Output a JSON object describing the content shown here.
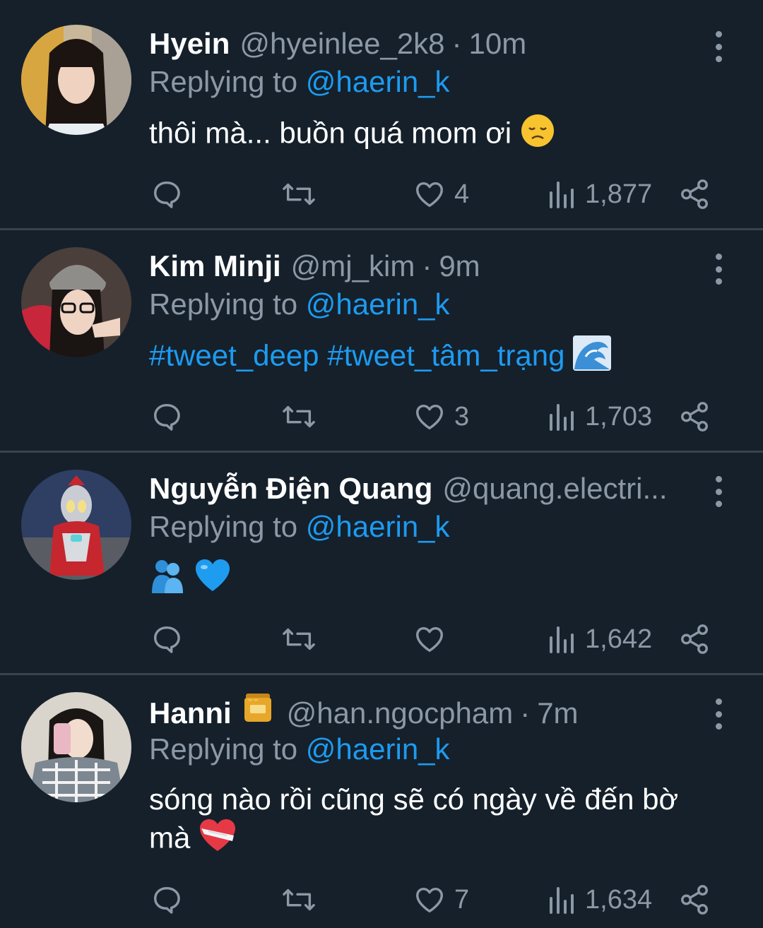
{
  "reply_prefix": "Replying to",
  "tweets": [
    {
      "name": "Hyein",
      "handle": "@hyeinlee_2k8",
      "separator": "·",
      "time": "10m",
      "reply_to": "@haerin_k",
      "text": "thôi mà... buồn quá mom ơi",
      "text_emoji": "disappointed-face",
      "likes": "4",
      "views": "1,877"
    },
    {
      "name": "Kim Minji",
      "handle": "@mj_kim",
      "separator": "·",
      "time": "9m",
      "reply_to": "@haerin_k",
      "hashtag1": "#tweet_deep",
      "hashtag2": "#tweet_tâm_trạng",
      "text_emoji": "water-wave",
      "likes": "3",
      "views": "1,703"
    },
    {
      "name": "Nguyễn Điện Quang",
      "handle": "@quang.electri...",
      "reply_to": "@haerin_k",
      "text_emoji": "people-hugging, blue-heart",
      "likes": "",
      "views": "1,642"
    },
    {
      "name": "Hanni",
      "name_emoji": "honey-pot",
      "handle": "@han.ngocpham",
      "separator": "·",
      "time": "7m",
      "reply_to": "@haerin_k",
      "text_line1": "sóng nào rồi cũng sẽ có ngày về đến bờ",
      "text_line2": "mà",
      "text_emoji": "mending-heart",
      "likes": "7",
      "views": "1,634"
    }
  ],
  "colors": {
    "background": "#15202b",
    "divider": "#38444d",
    "muted": "#8b98a5",
    "accent": "#1d9bf0"
  }
}
